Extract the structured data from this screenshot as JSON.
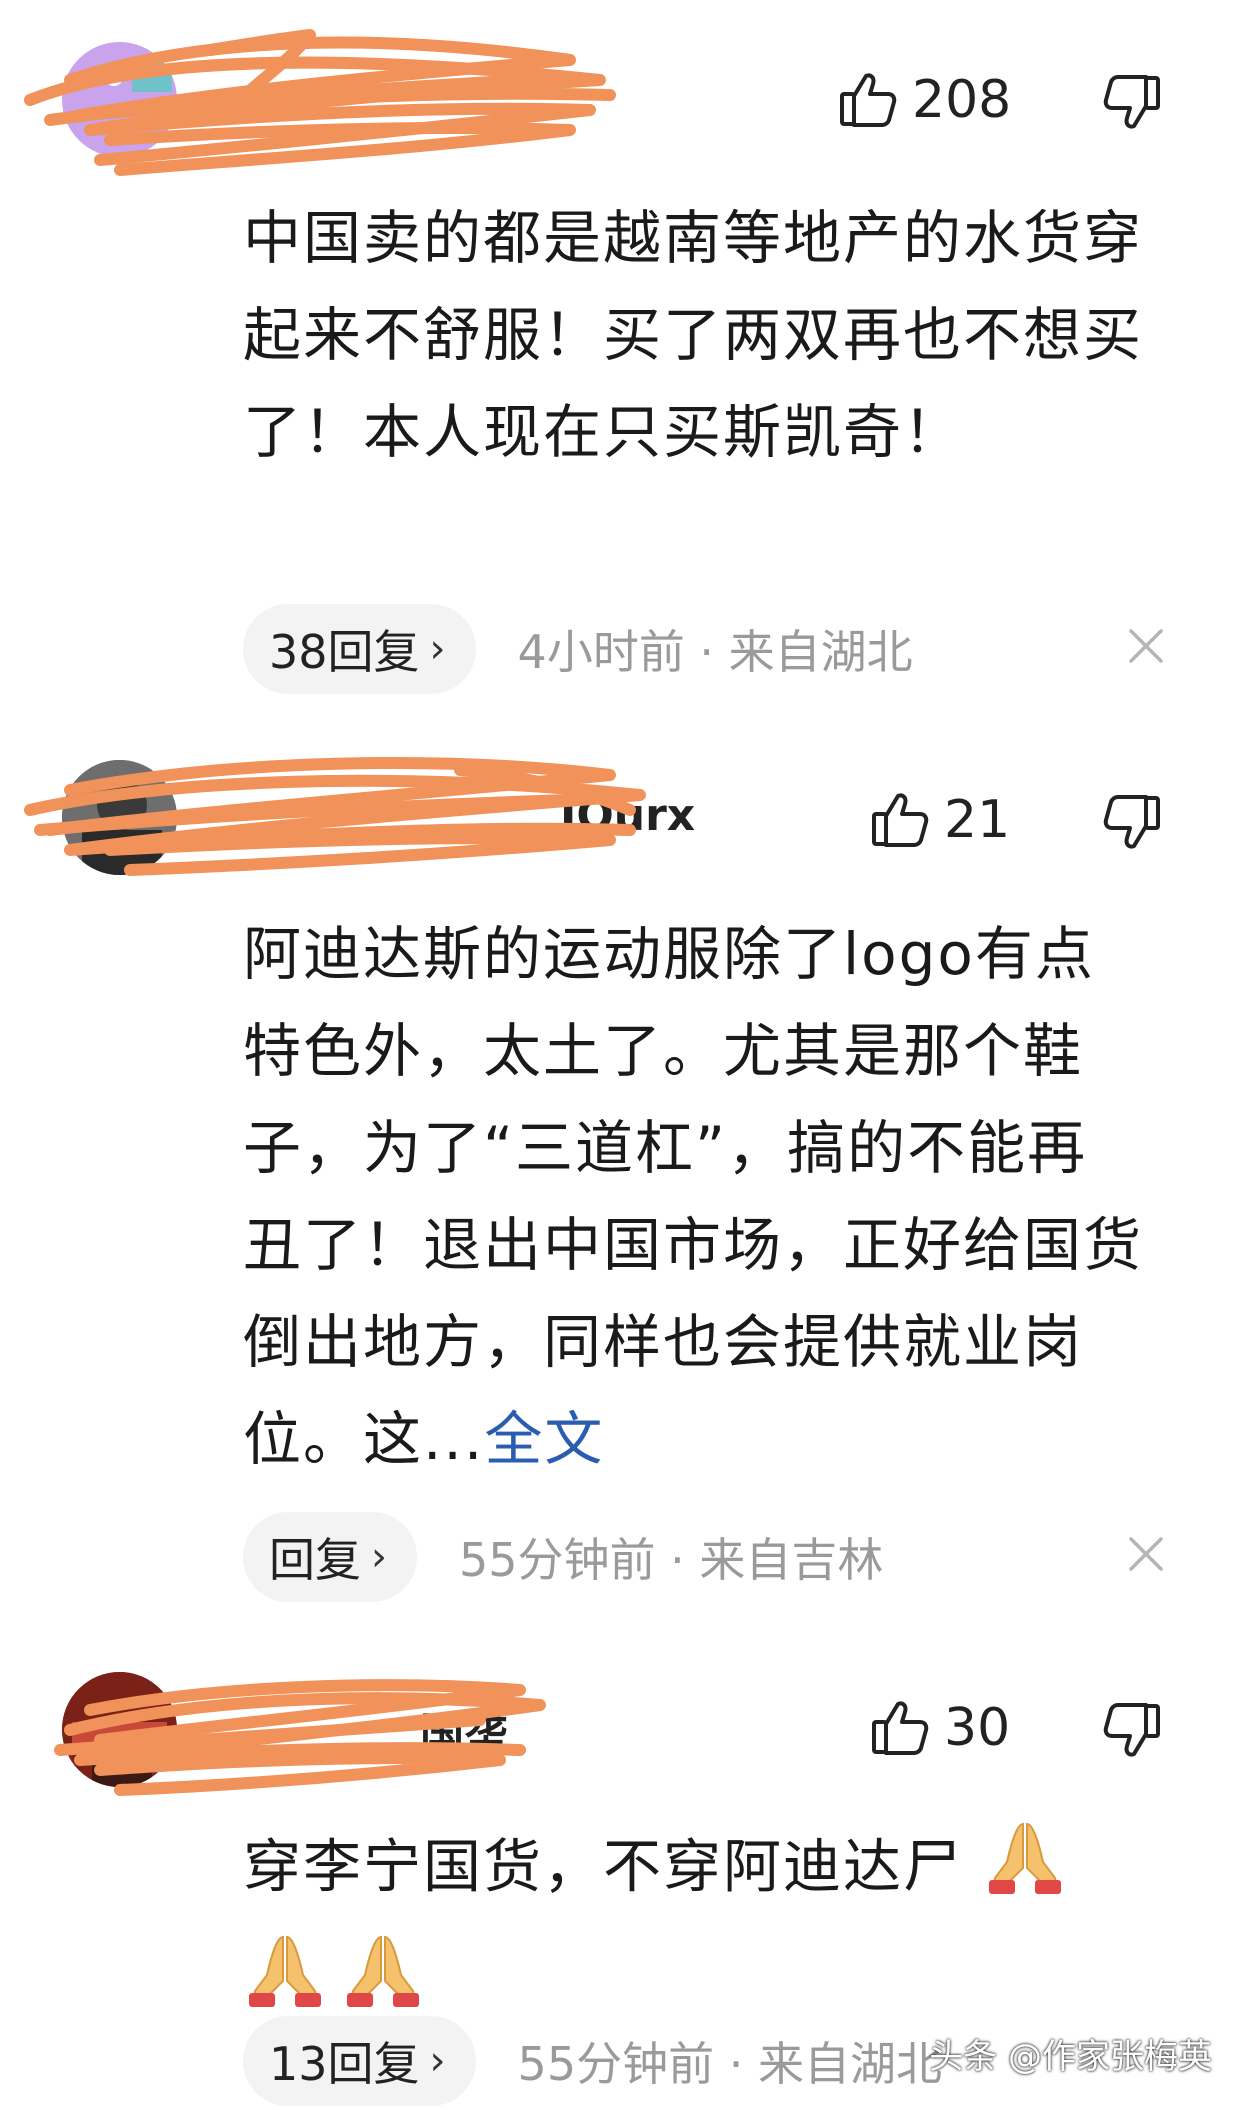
{
  "comments": [
    {
      "username": "",
      "likes": "208",
      "content": "中国卖的都是越南等地产的水货穿起来不舒服！买了两双再也不想买了！本人现在只买斯凯奇！",
      "more_label": "",
      "reply_label": "38回复",
      "chevron": "›",
      "meta": "4小时前 · 来自湖北"
    },
    {
      "username": "JOurx",
      "likes": "21",
      "content": "阿迪达斯的运动服除了logo有点特色外，太土了。尤其是那个鞋子，为了“三道杠”，搞的不能再丑了！退出中国市场，正好给国货倒出地方，同样也会提供就业岗位。这...",
      "more_label": "全文",
      "reply_label": "回复",
      "chevron": "›",
      "meta": "55分钟前 · 来自吉林"
    },
    {
      "username": "国垄",
      "likes": "30",
      "content": "穿李宁国货，不穿阿迪达尸",
      "emoji_count": 3,
      "more_label": "",
      "reply_label": "13回复",
      "chevron": "›",
      "meta": "55分钟前 · 来自湖北"
    }
  ],
  "watermark": "头条 @作家张梅英",
  "colors": {
    "scribble": "#f0925a",
    "link": "#2a5db0",
    "meta": "#9a9a9a",
    "pill": "#f3f3f3"
  },
  "icons": {
    "like": "thumbs-up-icon",
    "dislike": "thumbs-down-icon",
    "close": "close-icon",
    "emoji": "folded-hands-emoji"
  }
}
